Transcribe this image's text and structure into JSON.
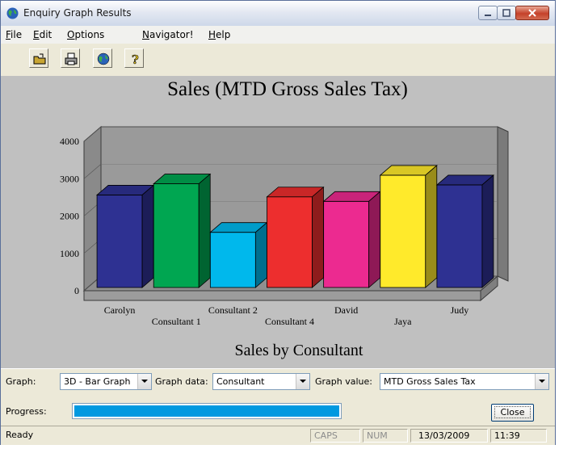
{
  "window": {
    "title": "Enquiry Graph Results"
  },
  "menu": [
    {
      "u": "F",
      "rest": "ile"
    },
    {
      "u": "E",
      "rest": "dit"
    },
    {
      "u": "O",
      "rest": "ptions"
    },
    {
      "u": "N",
      "rest": "avigator!"
    },
    {
      "u": "H",
      "rest": "elp"
    }
  ],
  "toolbar": {
    "icons": [
      "open-folder-icon",
      "print-icon",
      "globe-icon",
      "help-icon"
    ]
  },
  "controls": {
    "graph_label": "Graph:",
    "graph_value": "3D - Bar Graph",
    "graph_data_label": "Graph data:",
    "graph_data_value": "Consultant",
    "graph_value_label": "Graph value:",
    "graph_value_value": "MTD Gross Sales Tax"
  },
  "progress": {
    "label": "Progress:",
    "value": 1.0
  },
  "close_label": "Close",
  "status": {
    "text": "Ready",
    "caps": "CAPS",
    "num": "NUM",
    "date": "13/03/2009",
    "time": "11:39"
  },
  "chart_data": {
    "type": "bar",
    "title": "Sales (MTD Gross Sales Tax)",
    "xlabel": "Sales by Consultant",
    "ylabel": "",
    "ylim": [
      0,
      4000
    ],
    "yticks": [
      0,
      1000,
      2000,
      3000,
      4000
    ],
    "categories": [
      "Carolyn",
      "Consultant 1",
      "Consultant 2",
      "Consultant 4",
      "David",
      "Jaya",
      "Judy"
    ],
    "values": [
      2650,
      2950,
      1650,
      2600,
      2480,
      3180,
      2920
    ],
    "colors": [
      "#2e3192",
      "#00a651",
      "#00b8ec",
      "#ed2e2e",
      "#ec2a90",
      "#ffea2b",
      "#2e3192"
    ]
  }
}
